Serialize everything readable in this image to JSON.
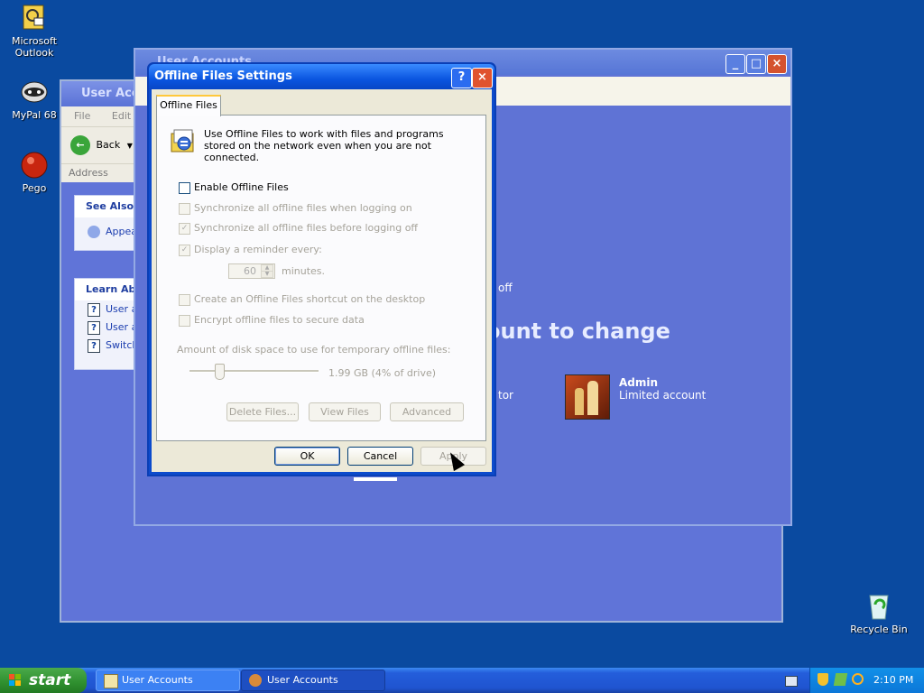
{
  "desktop": {
    "icons": [
      {
        "label_line1": "Microsoft",
        "label_line2": "Outlook"
      },
      {
        "label_line1": "MyPal 68",
        "label_line2": ""
      },
      {
        "label_line1": "Pego",
        "label_line2": ""
      },
      {
        "label_line1": "Recycle Bin",
        "label_line2": ""
      }
    ]
  },
  "back_window": {
    "title": "User Acco",
    "menu": [
      "File",
      "Edit"
    ],
    "back_label": "Back",
    "address_label": "Address",
    "see_also": {
      "title": "See Also",
      "items": [
        "Appea"
      ]
    },
    "learn_about": {
      "title": "Learn Abo",
      "items": [
        "User a",
        "User a",
        "Switch"
      ]
    }
  },
  "main_window": {
    "title": "User Accounts",
    "partial_off": "off",
    "heading_fragment": "ount to change",
    "admin_fragment": "tor",
    "account": {
      "name": "Admin",
      "type": "Limited account"
    }
  },
  "dialog": {
    "title": "Offline Files Settings",
    "help_glyph": "?",
    "close_glyph": "×",
    "tab_label": "Offline Files",
    "description": "Use Offline Files to work with files and programs stored on the network even when you are not connected.",
    "enable_label": "Enable Offline Files",
    "sync_logon_label": "Synchronize all offline files when logging on",
    "sync_logoff_label": "Synchronize all offline files before logging off",
    "reminder_label": "Display a reminder every:",
    "reminder_value": "60",
    "minutes_label": "minutes.",
    "shortcut_label": "Create an Offline Files shortcut on the desktop",
    "encrypt_label": "Encrypt offline files to secure data",
    "disk_space_label": "Amount of disk space to use for temporary offline files:",
    "disk_space_value": "1.99 GB (4% of drive)",
    "delete_files_label": "Delete Files...",
    "view_files_label": "View Files",
    "advanced_label": "Advanced",
    "ok_label": "OK",
    "cancel_label": "Cancel",
    "apply_label": "Apply"
  },
  "taskbar": {
    "start_label": "start",
    "buttons": [
      "User Accounts",
      "User Accounts"
    ],
    "clock": "2:10 PM"
  }
}
